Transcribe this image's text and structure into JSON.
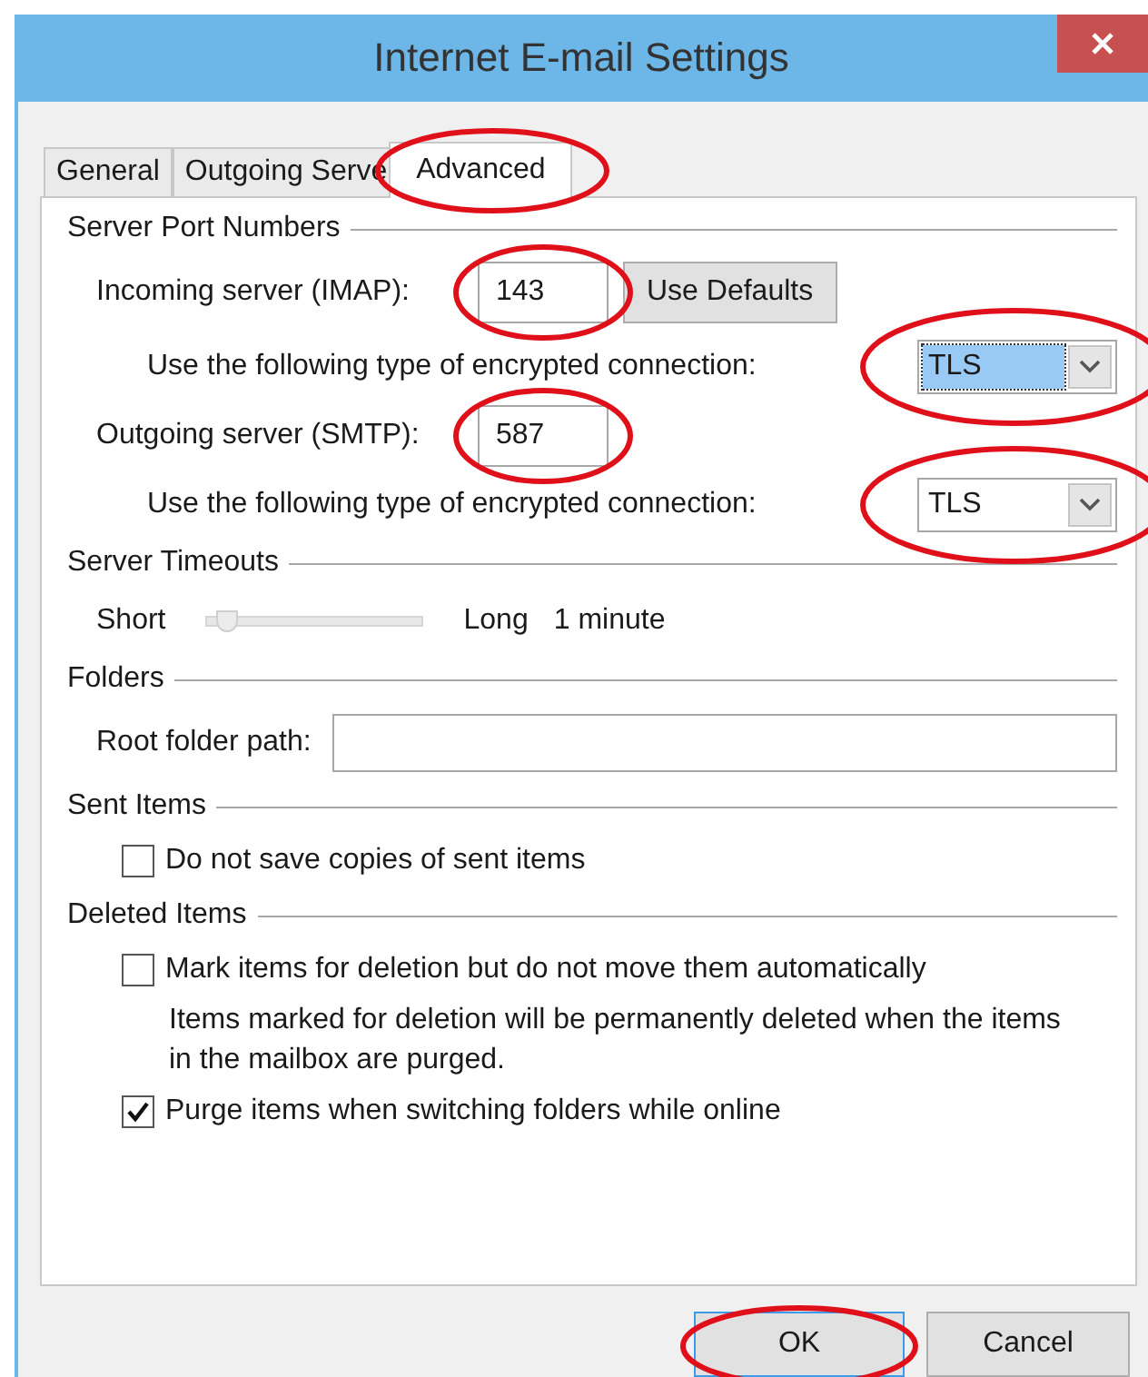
{
  "window": {
    "title": "Internet E-mail Settings"
  },
  "tabs": [
    {
      "label": "General",
      "selected": false,
      "circled": false
    },
    {
      "label": "Outgoing Serve",
      "selected": false,
      "circled": false
    },
    {
      "label": "Advanced",
      "selected": true,
      "circled": true
    }
  ],
  "ports": {
    "title": "Server Port Numbers",
    "servers": [
      {
        "label": "Incoming server (IMAP):",
        "value": "143",
        "circled": true,
        "button": "Use Defaults",
        "encryption_label": "Use the following type of encrypted connection:",
        "encryption": "TLS",
        "encryption_focused": true,
        "encryption_circled": true
      },
      {
        "label": "Outgoing server (SMTP):",
        "value": "587",
        "circled": true,
        "encryption_label": "Use the following type of encrypted connection:",
        "encryption": "TLS",
        "encryption_focused": false,
        "encryption_circled": true
      }
    ]
  },
  "timeouts": {
    "title": "Server Timeouts",
    "min_label": "Short",
    "max_label": "Long",
    "reading": "1 minute",
    "level": 0.05
  },
  "folders": {
    "title": "Folders",
    "label": "Root folder path:"
  },
  "sent_items": {
    "title": "Sent Items",
    "options": [
      {
        "label": "Do not save copies of sent items",
        "checked": false
      }
    ]
  },
  "deleted_items": {
    "title": "Deleted Items",
    "options": [
      {
        "label": "Mark items for deletion but do not move them automatically",
        "checked": false,
        "note": "Items marked for deletion will be permanently deleted when the items in the mailbox are purged."
      },
      {
        "label": "Purge items when switching folders while online",
        "checked": true
      }
    ]
  },
  "buttons": [
    {
      "label": "OK",
      "default": true,
      "circled": true
    },
    {
      "label": "Cancel",
      "default": false,
      "circled": false
    }
  ]
}
